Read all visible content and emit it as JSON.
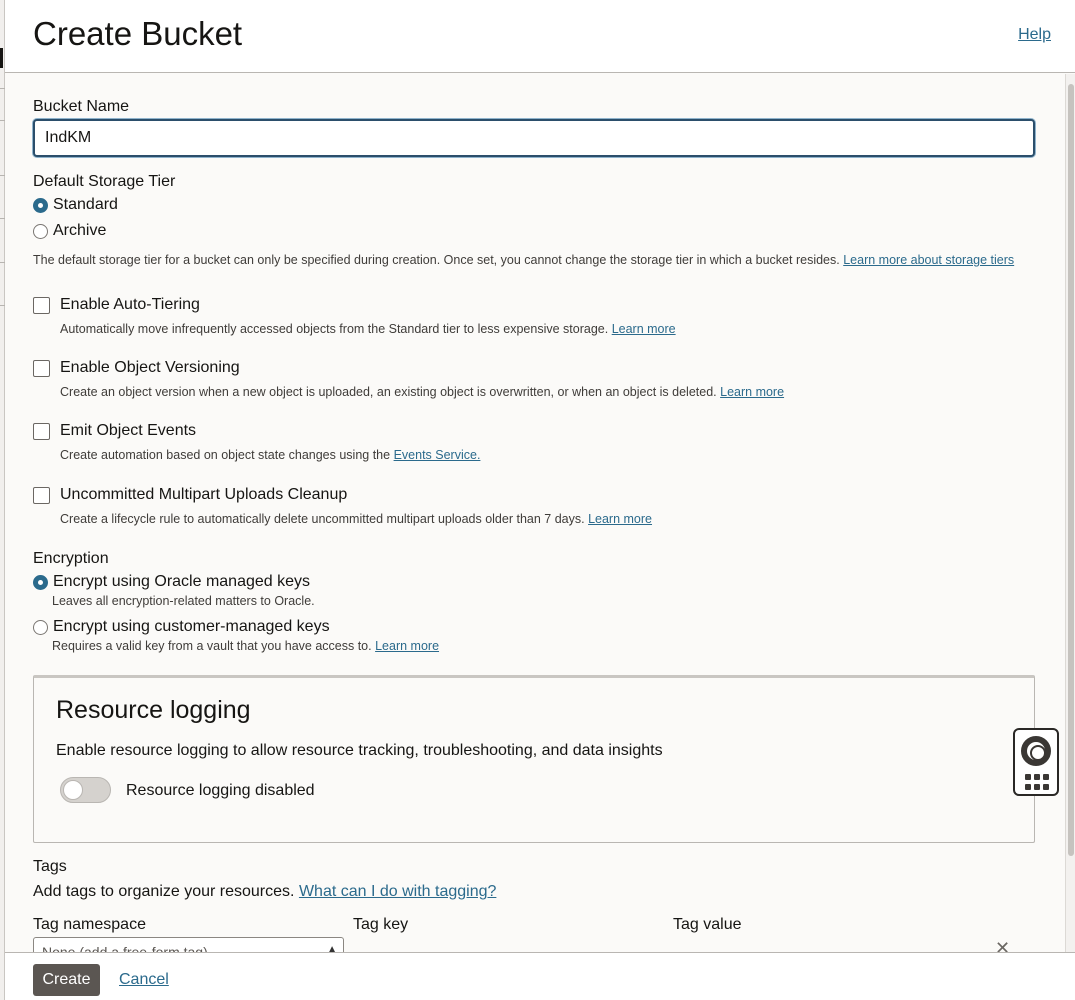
{
  "header": {
    "title": "Create Bucket",
    "help_label": "Help"
  },
  "bucket_name": {
    "label": "Bucket Name",
    "value": "IndKM"
  },
  "storage_tier": {
    "label": "Default Storage Tier",
    "options": [
      "Standard",
      "Archive"
    ],
    "selected": "Standard",
    "help_text": "The default storage tier for a bucket can only be specified during creation. Once set, you cannot change the storage tier in which a bucket resides.",
    "help_link": "Learn more about storage tiers"
  },
  "options": [
    {
      "label": "Enable Auto-Tiering",
      "checked": false,
      "help_text": "Automatically move infrequently accessed objects from the Standard tier to less expensive storage.",
      "link": "Learn more"
    },
    {
      "label": "Enable Object Versioning",
      "checked": false,
      "help_text": "Create an object version when a new object is uploaded, an existing object is overwritten, or when an object is deleted.",
      "link": "Learn more"
    },
    {
      "label": "Emit Object Events",
      "checked": false,
      "help_text": "Create automation based on object state changes using the",
      "link": "Events Service."
    },
    {
      "label": "Uncommitted Multipart Uploads Cleanup",
      "checked": false,
      "help_text": "Create a lifecycle rule to automatically delete uncommitted multipart uploads older than 7 days.",
      "link": "Learn more"
    }
  ],
  "encryption": {
    "label": "Encryption",
    "options": [
      {
        "label": "Encrypt using Oracle managed keys",
        "checked": true,
        "description": "Leaves all encryption-related matters to Oracle.",
        "link": ""
      },
      {
        "label": "Encrypt using customer-managed keys",
        "checked": false,
        "description": "Requires a valid key from a vault that you have access to.",
        "link": "Learn more"
      }
    ]
  },
  "resource_logging": {
    "title": "Resource logging",
    "description": "Enable resource logging to allow resource tracking, troubleshooting, and data insights",
    "toggle_label": "Resource logging disabled",
    "enabled": false
  },
  "tags": {
    "label": "Tags",
    "description": "Add tags to organize your resources.",
    "link": "What can I do with tagging?",
    "columns": [
      "Tag namespace",
      "Tag key",
      "Tag value"
    ],
    "namespace_value": "None (add a free-form tag)",
    "key_value": "",
    "tag_value": ""
  },
  "footer": {
    "create_label": "Create",
    "cancel_label": "Cancel"
  },
  "colors": {
    "accent": "#2b6a8c",
    "primary_button": "#5b5652",
    "background": "#fbfaf8"
  },
  "icons": {
    "support": "lifebuoy-icon",
    "apps": "grid-icon",
    "remove": "close-icon"
  }
}
